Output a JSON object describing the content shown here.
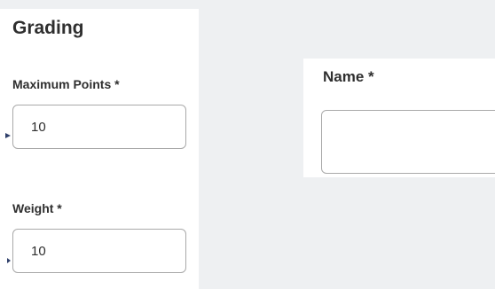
{
  "grading": {
    "title": "Grading",
    "max_points_label": "Maximum Points *",
    "max_points_value": "10",
    "weight_label": "Weight *",
    "weight_value": "10"
  },
  "name_form": {
    "label": "Name *",
    "value": ""
  },
  "icons": {
    "pointer": "caret-right-icon"
  },
  "colors": {
    "background": "#eef0f2",
    "panel": "#ffffff",
    "border": "#a9a9a9",
    "text": "#2f2f2f",
    "pointer": "#2f3f6a"
  }
}
